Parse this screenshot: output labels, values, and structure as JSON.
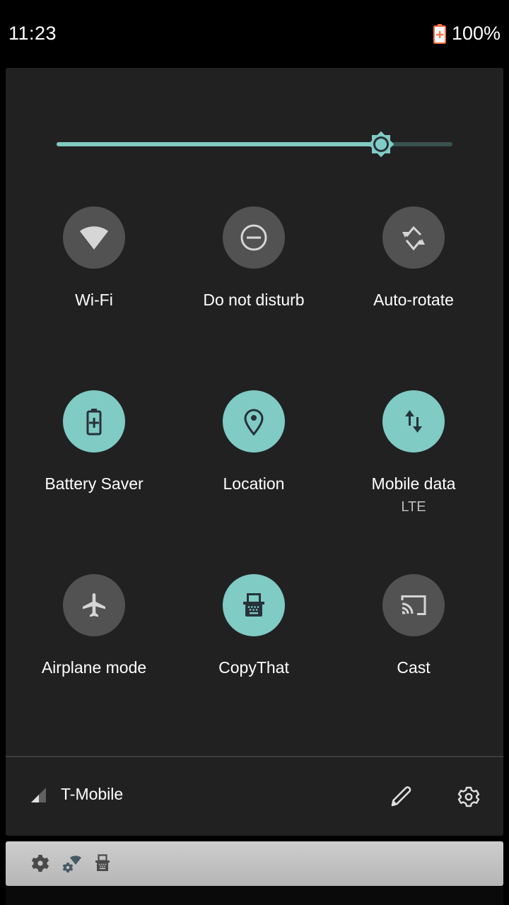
{
  "status_bar": {
    "time": "11:23",
    "battery_icon": "battery-charging-icon",
    "battery_percent": "100%",
    "battery_color": "#ff7043"
  },
  "brightness": {
    "icon": "brightness-icon",
    "level_percent": 82,
    "accent_color": "#80cbc4"
  },
  "tiles": [
    {
      "id": "wifi",
      "label": "Wi-Fi",
      "icon": "wifi-icon",
      "active": false
    },
    {
      "id": "dnd",
      "label": "Do not disturb",
      "icon": "do-not-disturb-icon",
      "active": false
    },
    {
      "id": "autorotate",
      "label": "Auto-rotate",
      "icon": "auto-rotate-icon",
      "active": false
    },
    {
      "id": "battery-saver",
      "label": "Battery Saver",
      "icon": "battery-saver-icon",
      "active": true
    },
    {
      "id": "location",
      "label": "Location",
      "icon": "location-pin-icon",
      "active": true
    },
    {
      "id": "mobile-data",
      "label": "Mobile data",
      "sublabel": "LTE",
      "icon": "mobile-data-icon",
      "active": true
    },
    {
      "id": "airplane",
      "label": "Airplane mode",
      "icon": "airplane-icon",
      "active": false
    },
    {
      "id": "copythat",
      "label": "CopyThat",
      "icon": "typewriter-icon",
      "active": true
    },
    {
      "id": "cast",
      "label": "Cast",
      "icon": "cast-icon",
      "active": false
    }
  ],
  "footer": {
    "carrier": "T-Mobile",
    "signal_icon": "signal-icon",
    "edit_icon": "pencil-icon",
    "settings_icon": "gear-icon"
  },
  "notification_icons": [
    "gear-icon",
    "wifi-settings-icon",
    "typewriter-icon"
  ]
}
